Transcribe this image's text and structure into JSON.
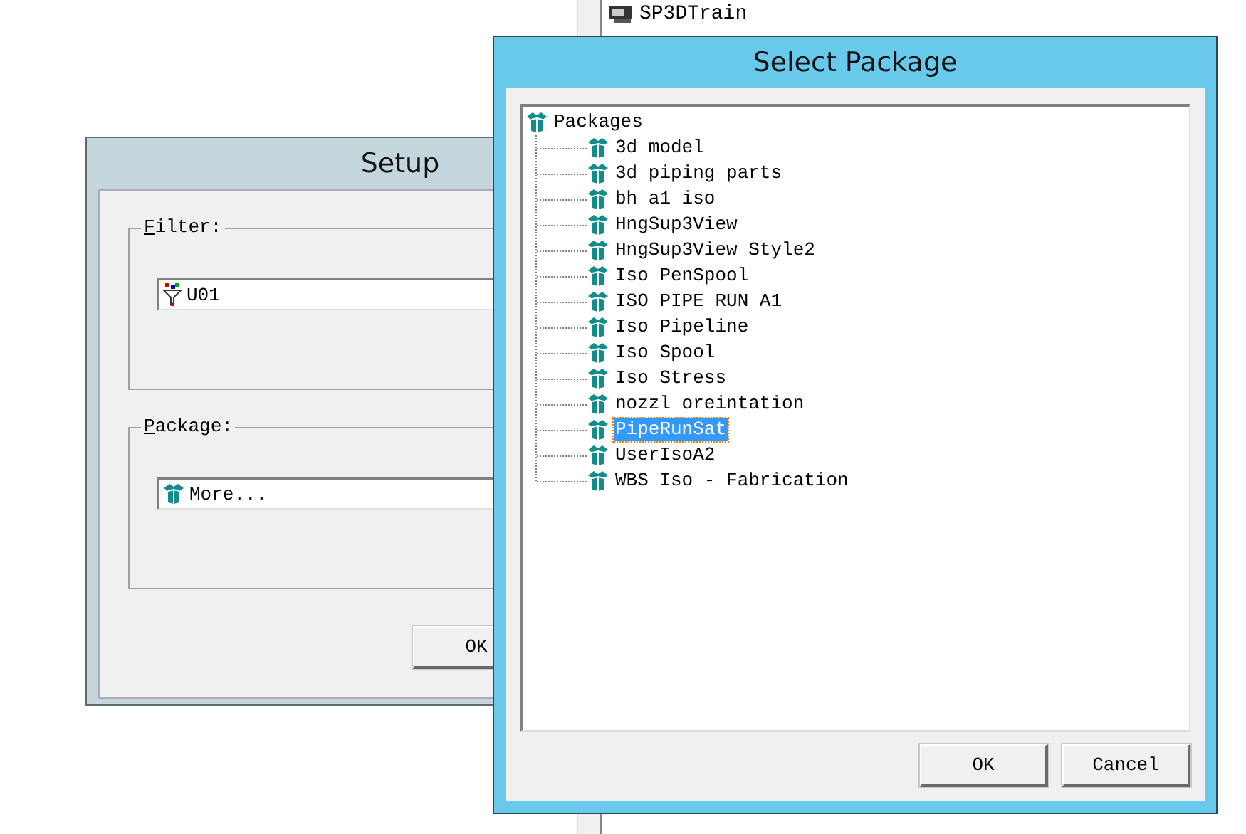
{
  "background_window": {
    "tree": [
      {
        "label": "SP3DTrain"
      }
    ]
  },
  "setup_window": {
    "title": "Setup",
    "groups": [
      {
        "label": "Filter:",
        "value": "U01",
        "kind": "filter"
      },
      {
        "label": "Package:",
        "value": "More...",
        "kind": "package"
      }
    ],
    "buttons": [
      "OK"
    ]
  },
  "select_package_window": {
    "title": "Select Package",
    "tree": {
      "label": "Packages",
      "children": [
        {
          "label": "3d model",
          "selected": false
        },
        {
          "label": "3d piping parts",
          "selected": false
        },
        {
          "label": "bh a1 iso",
          "selected": false
        },
        {
          "label": "HngSup3View",
          "selected": false
        },
        {
          "label": "HngSup3View Style2",
          "selected": false
        },
        {
          "label": "Iso PenSpool",
          "selected": false
        },
        {
          "label": "ISO PIPE RUN A1",
          "selected": false
        },
        {
          "label": "Iso Pipeline",
          "selected": false
        },
        {
          "label": "Iso Spool",
          "selected": false
        },
        {
          "label": "Iso Stress",
          "selected": false
        },
        {
          "label": "nozzl oreintation",
          "selected": false
        },
        {
          "label": "PipeRunSat",
          "selected": true
        },
        {
          "label": "UserIsoA2",
          "selected": false
        },
        {
          "label": "WBS Iso - Fabrication",
          "selected": false
        }
      ]
    },
    "buttons": [
      "OK",
      "Cancel"
    ]
  }
}
